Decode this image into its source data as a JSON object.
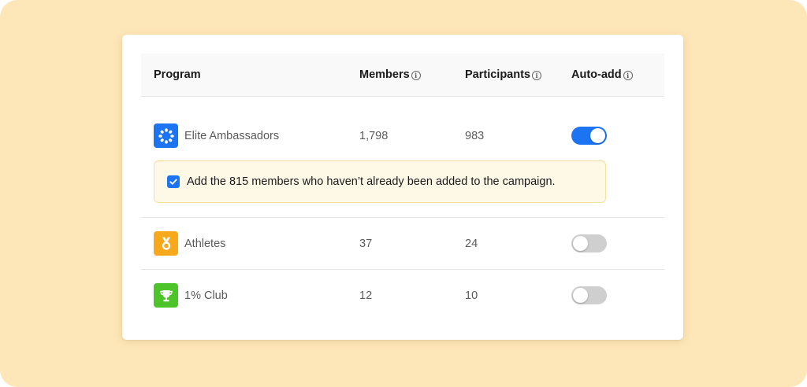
{
  "table": {
    "headers": {
      "program": "Program",
      "members": "Members",
      "participants": "Participants",
      "auto_add": "Auto-add"
    },
    "rows": [
      {
        "name": "Elite Ambassadors",
        "members": "1,798",
        "participants": "983",
        "auto_add": true,
        "icon": "laurel-wreath-icon",
        "icon_color": "#1c74f2"
      },
      {
        "name": "Athletes",
        "members": "37",
        "participants": "24",
        "auto_add": false,
        "icon": "medal-icon",
        "icon_color": "#f7a81b"
      },
      {
        "name": "1% Club",
        "members": "12",
        "participants": "10",
        "auto_add": false,
        "icon": "trophy-icon",
        "icon_color": "#4cc42a"
      }
    ]
  },
  "notice": {
    "checked": true,
    "text": "Add the 815 members who haven’t already been added to the campaign."
  },
  "colors": {
    "background": "#fde6b8",
    "accent": "#1c74f2",
    "toggle_off": "#cfcfcf",
    "notice_bg": "#fef8e7",
    "notice_border": "#f5df9f"
  }
}
